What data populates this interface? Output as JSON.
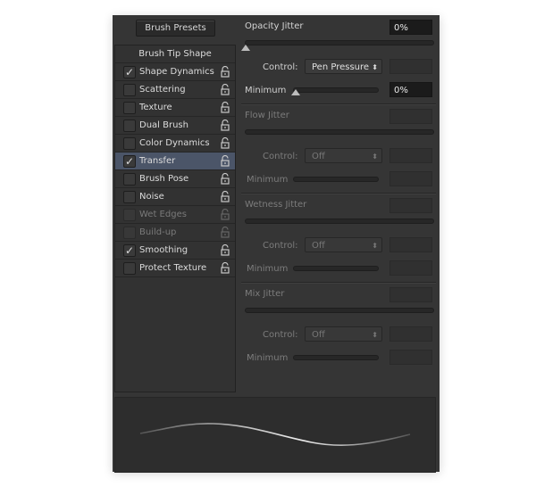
{
  "panel": {
    "brush_presets_label": "Brush Presets",
    "options": [
      {
        "label": "Brush Tip Shape",
        "header": true
      },
      {
        "label": "Shape Dynamics",
        "checked": true,
        "enabled": true
      },
      {
        "label": "Scattering",
        "checked": false,
        "enabled": true
      },
      {
        "label": "Texture",
        "checked": false,
        "enabled": true
      },
      {
        "label": "Dual Brush",
        "checked": false,
        "enabled": true
      },
      {
        "label": "Color Dynamics",
        "checked": false,
        "enabled": true
      },
      {
        "label": "Transfer",
        "checked": true,
        "enabled": true,
        "selected": true
      },
      {
        "label": "Brush Pose",
        "checked": false,
        "enabled": true
      },
      {
        "label": "Noise",
        "checked": false,
        "enabled": true
      },
      {
        "label": "Wet Edges",
        "checked": false,
        "enabled": false
      },
      {
        "label": "Build-up",
        "checked": false,
        "enabled": false
      },
      {
        "label": "Smoothing",
        "checked": true,
        "enabled": true
      },
      {
        "label": "Protect Texture",
        "checked": false,
        "enabled": true
      }
    ],
    "sections": [
      {
        "title": "Opacity Jitter",
        "value": "0%",
        "control_label": "Control:",
        "control": "Pen Pressure",
        "minimum_label": "Minimum",
        "minimum": "0%",
        "enabled": true,
        "jitter_level": 0,
        "minimum_level": 0
      },
      {
        "title": "Flow Jitter",
        "value": "",
        "control_label": "Control:",
        "control": "Off",
        "minimum_label": "Minimum",
        "minimum": "",
        "enabled": false
      },
      {
        "title": "Wetness Jitter",
        "value": "",
        "control_label": "Control:",
        "control": "Off",
        "minimum_label": "Minimum",
        "minimum": "",
        "enabled": false
      },
      {
        "title": "Mix Jitter",
        "value": "",
        "control_label": "Control:",
        "control": "Off",
        "minimum_label": "Minimum",
        "minimum": "",
        "enabled": false
      }
    ]
  },
  "colors": {
    "selected_row": "#4b5568",
    "panel_bg": "#353535"
  }
}
